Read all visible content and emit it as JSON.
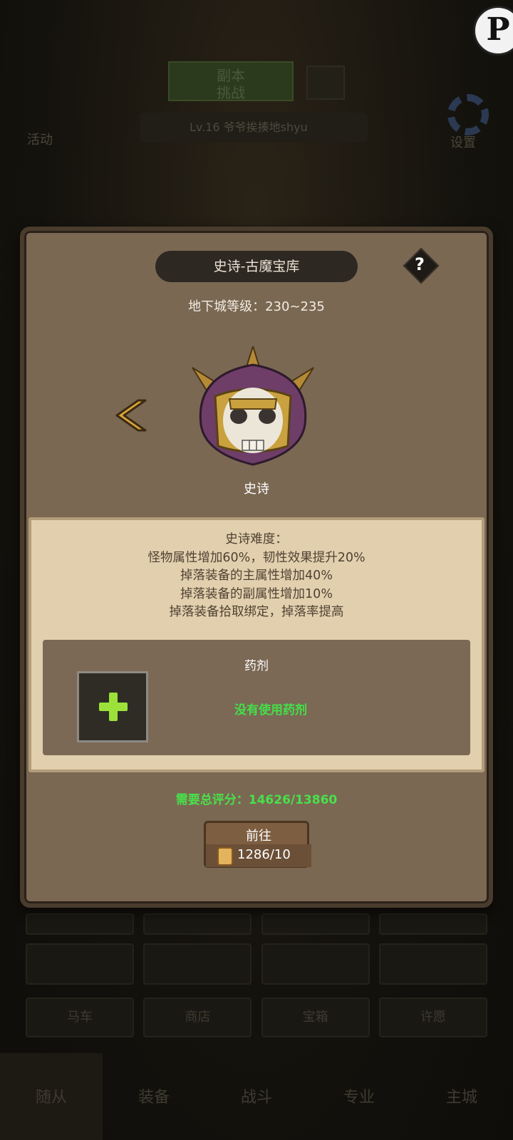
{
  "background": {
    "top_button": "副本\n挑战",
    "level_bar": "Lv.16 爷爷挨揍地shyu",
    "side_left_1": "活动",
    "side_right_1": "设置",
    "bottom_tabs": [
      "随从",
      "装备",
      "战斗",
      "专业",
      "主城"
    ],
    "slot_row_labels": [
      "马车",
      "商店",
      "宝箱",
      "许愿"
    ],
    "corner_badge": "P"
  },
  "dialog": {
    "title": "史诗-古魔宝库",
    "help": "?",
    "dungeon_level": "地下城等级：230~235",
    "difficulty_label": "史诗",
    "description": [
      "史诗难度：",
      "怪物属性增加60%，韧性效果提升20%",
      "掉落装备的主属性增加40%",
      "掉落装备的副属性增加10%",
      "掉落装备拾取绑定，掉落率提高"
    ],
    "potion_title": "药剂",
    "potion_status": "没有使用药剂",
    "score": "需要总评分：14626/13860",
    "go_label": "前往",
    "go_cost": "1286/10"
  },
  "colors": {
    "dialog_bg": "#7a6853",
    "parchment": "#e2cfae",
    "green_text": "#49e04a",
    "plus_green": "#9be13a"
  },
  "icons": {
    "arrow": "chevron-left-icon",
    "boss": "skull-helmet-icon",
    "scroll": "scroll-ticket-icon"
  }
}
